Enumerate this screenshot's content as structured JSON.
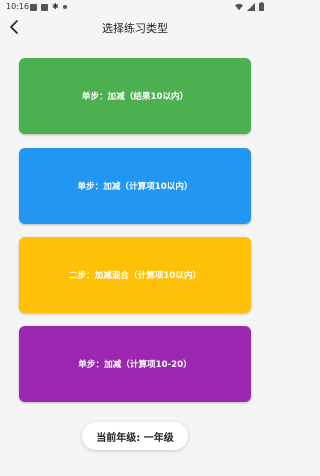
{
  "status_bar": {
    "time": "10:16"
  },
  "header": {
    "title": "选择练习类型"
  },
  "cards": [
    {
      "label": "单步：加减（结果10以内）",
      "color": "#4caf50"
    },
    {
      "label": "单步：加减（计算项10以内）",
      "color": "#2196f3"
    },
    {
      "label": "二步：加减混合（计算项10以内）",
      "color": "#ffc107"
    },
    {
      "label": "单步：加减（计算项10-20）",
      "color": "#9c27b0"
    }
  ],
  "grade": {
    "label": "当前年级: 一年级"
  }
}
